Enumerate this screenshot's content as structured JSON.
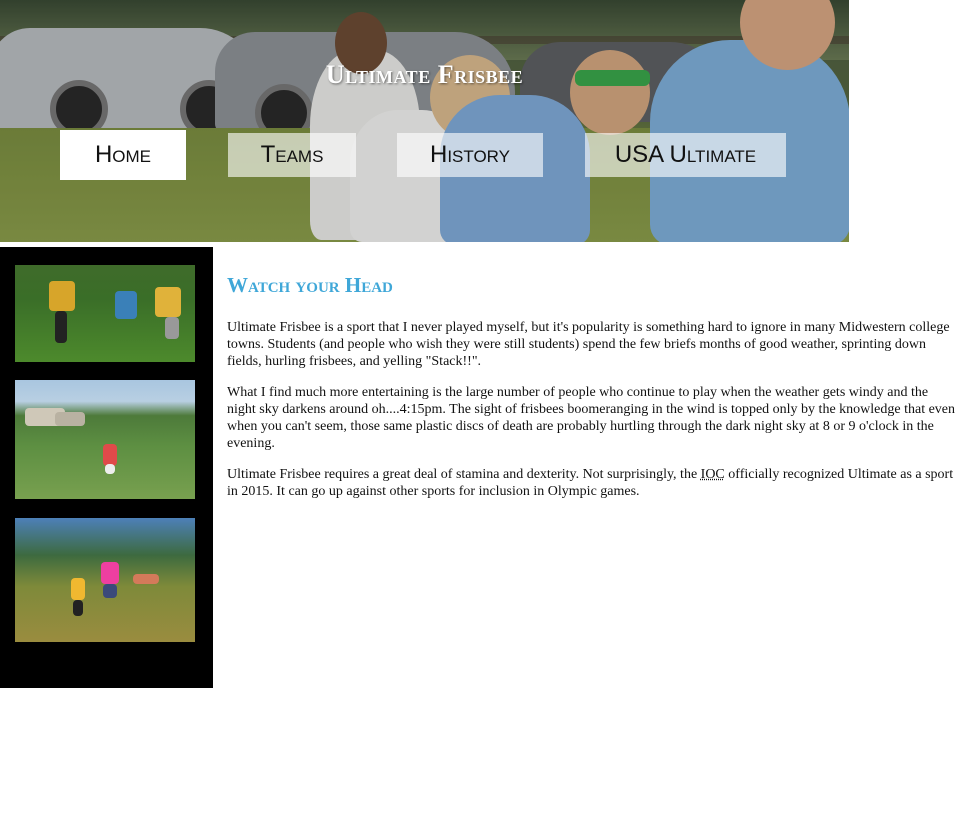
{
  "site": {
    "title": "Ultimate Frisbee"
  },
  "nav": [
    {
      "label": "Home",
      "active": true
    },
    {
      "label": "Teams"
    },
    {
      "label": "History"
    },
    {
      "label": "USA Ultimate"
    }
  ],
  "article": {
    "heading": "Watch your Head",
    "p1": "Ultimate Frisbee is a sport that I never played myself, but it's popularity is something hard to ignore in many Midwestern college towns. Students (and people who wish they were still students) spend the few briefs months of good weather, sprinting down fields, hurling frisbees, and yelling \"Stack!!\".",
    "p2": "What I find much more entertaining is the large number of people who continue to play when the weather gets windy and the night sky darkens around oh....4:15pm. The sight of frisbees boomeranging in the wind is topped only by the knowledge that even when you can't seem, those same plastic discs of death are probably hurtling through the dark night sky at 8 or 9 o'clock in the evening.",
    "p3_before": "Ultimate Frisbee requires a great deal of stamina and dexterity. Not surprisingly, the ",
    "p3_abbr": "IOC",
    "p3_after": " officially recognized Ultimate as a sport in 2015. It can go up against other sports for inclusion in Olympic games."
  },
  "colors": {
    "heading": "#3fa7d8",
    "sidebar": "#000000",
    "nav_active": "#ffffff"
  }
}
